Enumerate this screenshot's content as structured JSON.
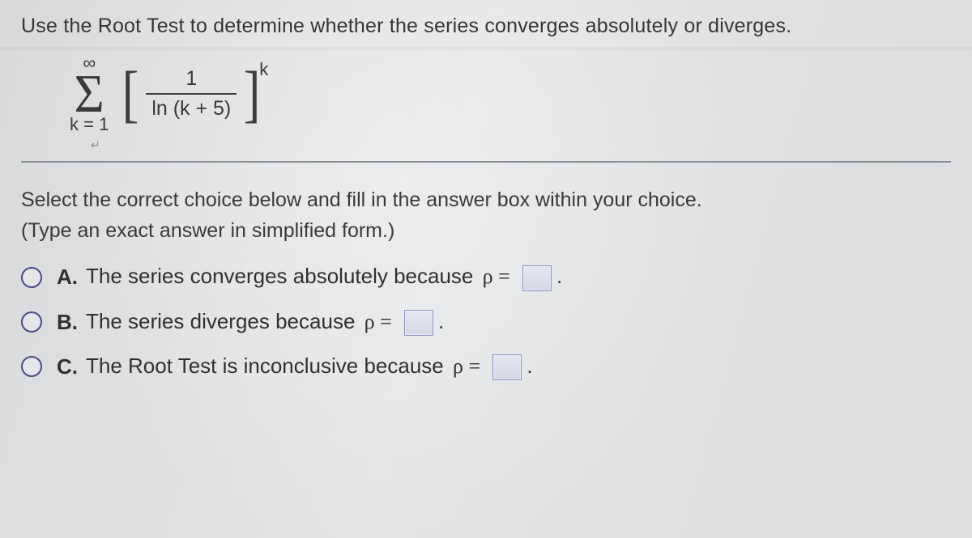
{
  "question": "Use the Root Test to determine whether the series converges absolutely or diverges.",
  "series": {
    "sigma_upper": "∞",
    "sigma_lower": "k = 1",
    "numerator": "1",
    "denominator": "ln (k + 5)",
    "exponent": "k"
  },
  "instruction_line1": "Select the correct choice below and fill in the answer box within your choice.",
  "instruction_line2": "(Type an exact answer in simplified form.)",
  "choices": [
    {
      "letter": "A.",
      "text_before": "The series converges absolutely because ",
      "rho_expr": "ρ =",
      "suffix": "."
    },
    {
      "letter": "B.",
      "text_before": "The series diverges because ",
      "rho_expr": "ρ =",
      "suffix": "."
    },
    {
      "letter": "C.",
      "text_before": "The Root Test is inconclusive because ",
      "rho_expr": "ρ =",
      "suffix": "."
    }
  ]
}
